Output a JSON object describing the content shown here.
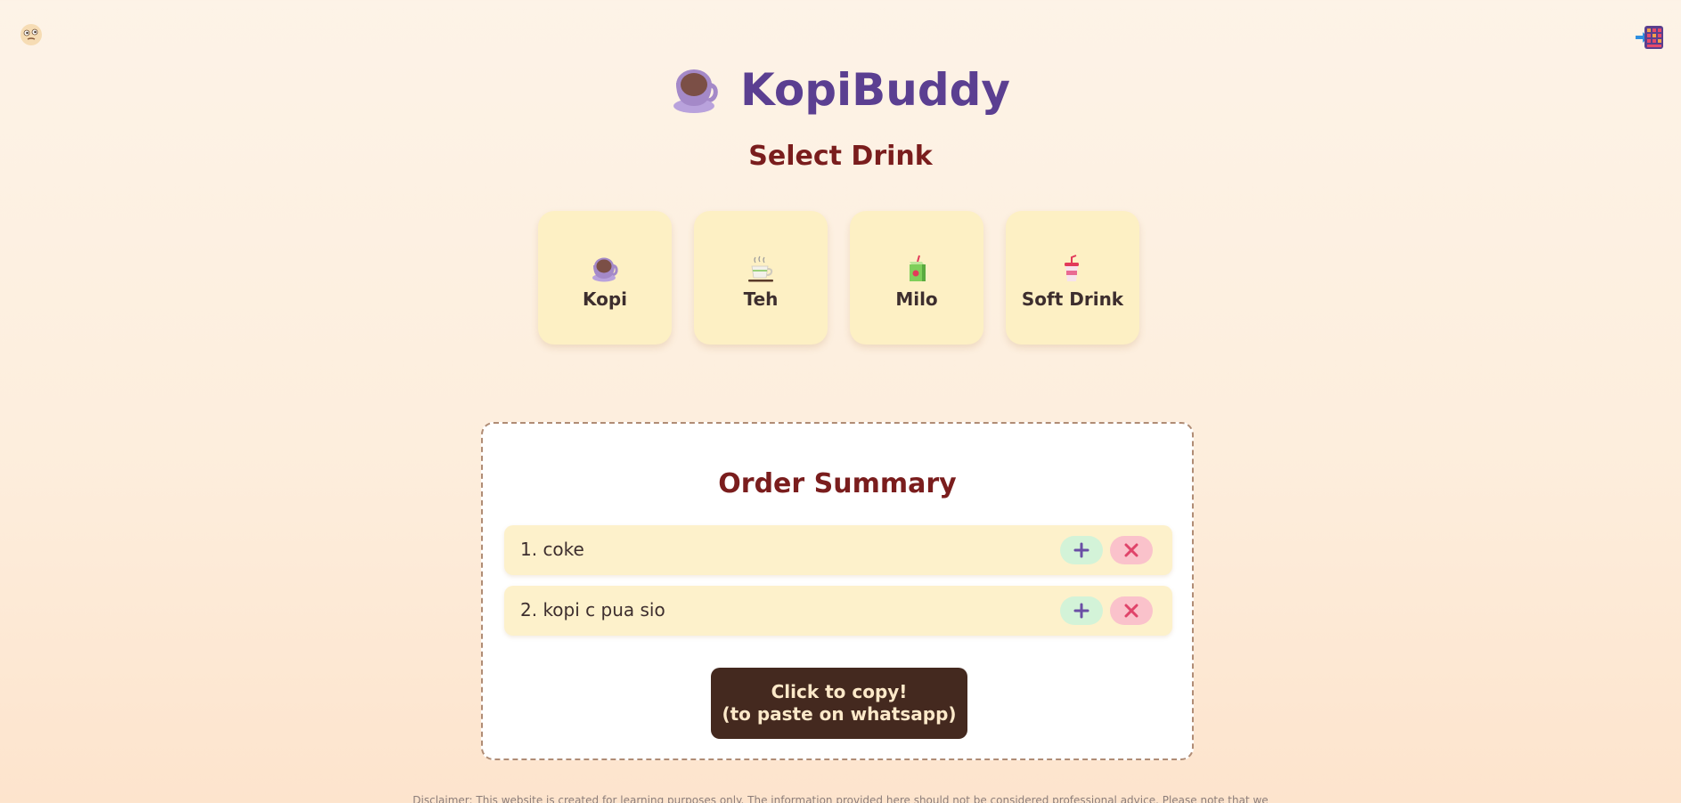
{
  "header": {
    "title": "KopiBuddy",
    "logo_icon": "coffee-cup-icon",
    "left_icon": "face-emoji-icon",
    "right_icon": "calculator-icon"
  },
  "drink_selection": {
    "title": "Select Drink",
    "options": [
      {
        "label": "Kopi",
        "icon": "coffee-cup-icon"
      },
      {
        "label": "Teh",
        "icon": "teacup-icon"
      },
      {
        "label": "Milo",
        "icon": "juice-box-icon"
      },
      {
        "label": "Soft Drink",
        "icon": "cup-with-straw-icon"
      }
    ]
  },
  "order_summary": {
    "title": "Order Summary",
    "items": [
      {
        "text": "1. coke"
      },
      {
        "text": "2. kopi c pua sio"
      }
    ],
    "copy_button": {
      "line1": "Click to copy!",
      "line2": "(to paste on whatsapp)"
    }
  },
  "footer": {
    "disclaimer": "Disclaimer: This website is created for learning purposes only. The information provided here should not be considered professional advice. Please note that we"
  },
  "colors": {
    "brand": "#5b3f91",
    "heading": "#7a1d1d",
    "card": "#fdf0c4",
    "copy_button": "#44291f",
    "add": "#d3f3d8",
    "remove": "#fac2cb"
  }
}
